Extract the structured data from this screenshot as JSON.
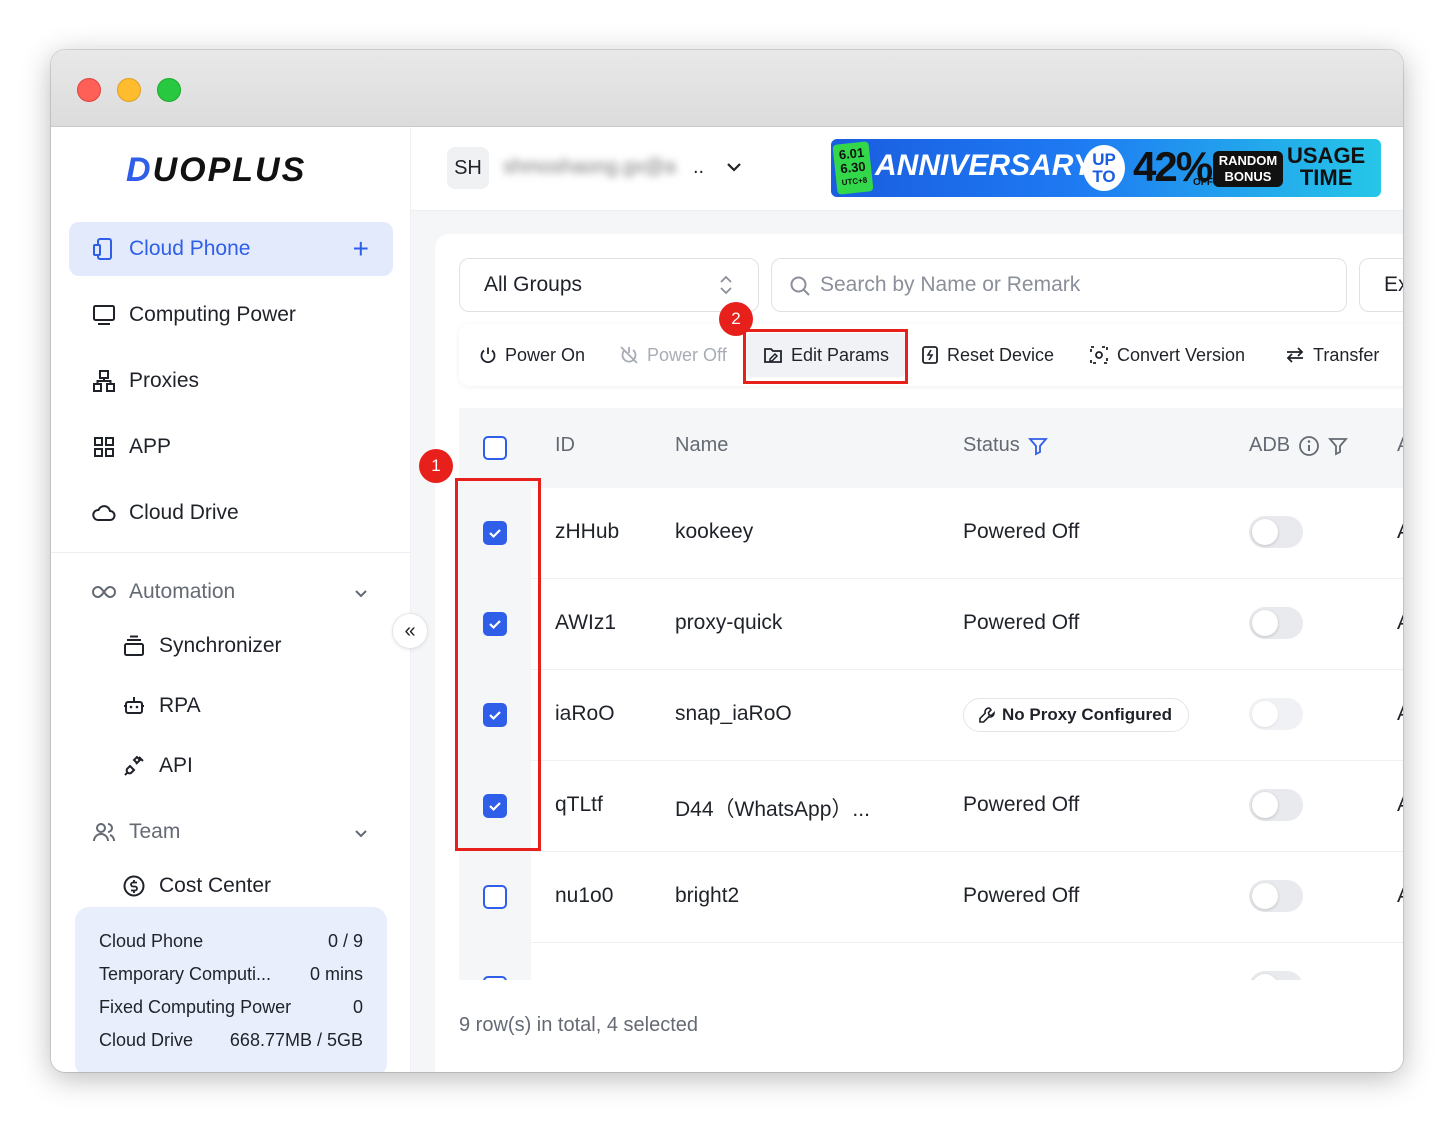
{
  "app": {
    "brand": "DUOPLUS"
  },
  "sidebar": {
    "items": [
      {
        "label": "Cloud Phone",
        "icon": "phone-icon"
      },
      {
        "label": "Computing Power",
        "icon": "monitor-icon"
      },
      {
        "label": "Proxies",
        "icon": "network-icon"
      },
      {
        "label": "APP",
        "icon": "grid-icon"
      },
      {
        "label": "Cloud Drive",
        "icon": "cloud-icon"
      }
    ],
    "automation": {
      "label": "Automation",
      "children": [
        {
          "label": "Synchronizer"
        },
        {
          "label": "RPA"
        },
        {
          "label": "API"
        }
      ]
    },
    "team": {
      "label": "Team",
      "children": [
        {
          "label": "Cost Center"
        }
      ]
    },
    "usage": [
      {
        "label": "Cloud Phone",
        "value": "0 / 9"
      },
      {
        "label": "Temporary Computi...",
        "value": "0 mins"
      },
      {
        "label": "Fixed Computing Power",
        "value": "0"
      },
      {
        "label": "Cloud Drive",
        "value": "668.77MB / 5GB"
      }
    ]
  },
  "header": {
    "avatar": "SH",
    "account": "shmoshaong.gx@a",
    "account_ellipsis": "..",
    "banner": {
      "date_lines": [
        "6.01",
        "6.30",
        "UTC+8"
      ],
      "anniversary": "ANNIVERSARY",
      "up_to": [
        "UP",
        "TO"
      ],
      "percent": "42%",
      "off": "OFF",
      "random_bonus": [
        "RANDOM",
        "BONUS"
      ],
      "usage_time": [
        "USAGE",
        "TIME"
      ]
    }
  },
  "filters": {
    "group_select": "All Groups",
    "search_placeholder": "Search by Name or Remark",
    "extra_button": "Ex"
  },
  "toolbar": {
    "power_on": "Power On",
    "power_off": "Power Off",
    "edit_params": "Edit Params",
    "reset_device": "Reset Device",
    "convert_version": "Convert Version",
    "transfer": "Transfer"
  },
  "annotations": {
    "badge1": "1",
    "badge2": "2"
  },
  "table": {
    "columns": {
      "id": "ID",
      "name": "Name",
      "status": "Status",
      "adb": "ADB",
      "next": "A"
    },
    "rows": [
      {
        "id": "zHHub",
        "name": "kookeey",
        "status": "Powered Off",
        "selected": true,
        "adb": false
      },
      {
        "id": "AWIz1",
        "name": "proxy-quick",
        "status": "Powered Off",
        "selected": true,
        "adb": false
      },
      {
        "id": "iaRoO",
        "name": "snap_iaRoO",
        "status": "No Proxy Configured",
        "selected": true,
        "adb": false
      },
      {
        "id": "qTLtf",
        "name": "D44（WhatsApp）...",
        "status": "Powered Off",
        "selected": true,
        "adb": false
      },
      {
        "id": "nu1o0",
        "name": "bright2",
        "status": "Powered Off",
        "selected": false,
        "adb": false
      }
    ]
  },
  "footer": {
    "summary": "9 row(s) in total, 4 selected"
  },
  "colors": {
    "accent": "#2f5ee8",
    "annotation_red": "#e8201c",
    "active_nav_bg": "#e3eafc"
  }
}
